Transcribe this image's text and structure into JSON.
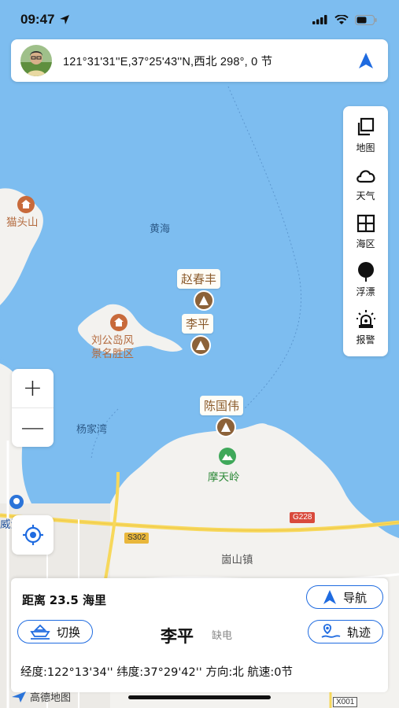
{
  "status_bar": {
    "time": "09:47"
  },
  "top_card": {
    "coords_text": "121°31'31''E,37°25'43''N,西北 298°, 0 节"
  },
  "toolbar": {
    "items": [
      {
        "label": "地图",
        "icon": "layers-icon"
      },
      {
        "label": "天气",
        "icon": "cloud-icon"
      },
      {
        "label": "海区",
        "icon": "grid-icon"
      },
      {
        "label": "浮漂",
        "icon": "buoy-icon"
      },
      {
        "label": "报警",
        "icon": "alarm-icon"
      }
    ]
  },
  "zoom": {
    "in_label": "+",
    "out_label": "—"
  },
  "map": {
    "labels": {
      "huanghai": "黄海",
      "maotoushan": "猫头山",
      "liugongdao_line1": "刘公岛风",
      "liugongdao_line2": "景名胜区",
      "yangjiawan": "杨家湾",
      "motianling": "摩天岭",
      "chongshan": "崮山镇",
      "weihai": "威海",
      "road_s302": "S302",
      "road_g228": "G228",
      "road_x001": "X001"
    },
    "vessels": [
      {
        "name": "赵春丰"
      },
      {
        "name": "李平"
      },
      {
        "name": "陈国伟"
      }
    ],
    "colors": {
      "sea": "#7dbdf0",
      "land": "#f3f2ef",
      "vessel": "#8c6239",
      "accent": "#1f6be0"
    }
  },
  "bottom": {
    "distance_label": "距离",
    "distance_value": "23.5 海里",
    "navigate_label": "导航",
    "switch_label": "切换",
    "vessel_name": "李平",
    "vessel_status": "缺电",
    "track_label": "轨迹",
    "info_text": "经度:122°13'34''  纬度:37°29'42''  方向:北  航速:0节"
  },
  "amap_logo": "高德地图"
}
